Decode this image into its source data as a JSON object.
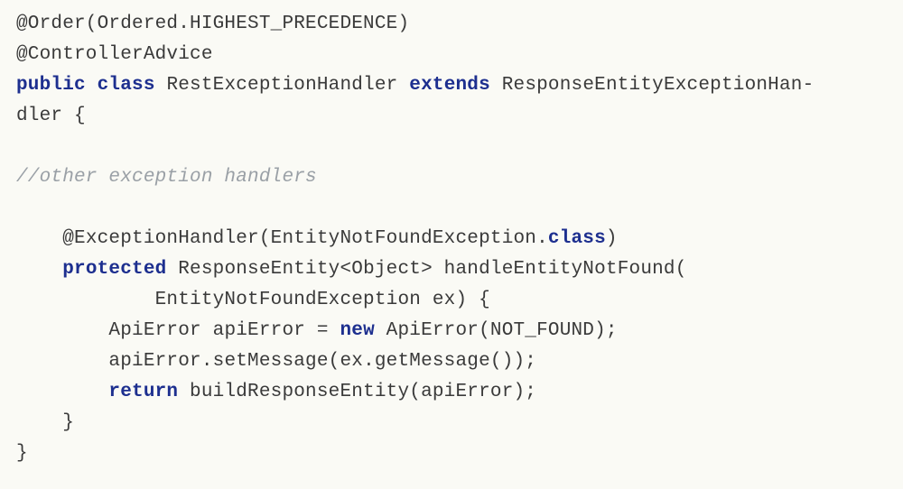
{
  "code": {
    "line1_pre": "@Order(Ordered.HIGHEST_PRECEDENCE)",
    "line2": "@ControllerAdvice",
    "l3_kw1": "public",
    "l3_kw2": "class",
    "l3_name": " RestExceptionHandler ",
    "l3_kw3": "extends",
    "l3_tail": " ResponseEntityExceptionHan-",
    "line4": "dler {",
    "blank": "",
    "comment": "//other exception handlers",
    "l8_pre": "    @ExceptionHandler(EntityNotFoundException.",
    "l8_kw": "class",
    "l8_post": ")",
    "l9_indent": "    ",
    "l9_kw": "protected",
    "l9_tail": " ResponseEntity<Object> handleEntityNotFound(",
    "line10": "            EntityNotFoundException ex) {",
    "l11_pre": "        ApiError apiError = ",
    "l11_kw": "new",
    "l11_post": " ApiError(NOT_FOUND);",
    "line12": "        apiError.setMessage(ex.getMessage()); ",
    "l13_indent": "        ",
    "l13_kw": "return",
    "l13_tail": " buildResponseEntity(apiError);",
    "line14": "    }",
    "line15": "}"
  }
}
